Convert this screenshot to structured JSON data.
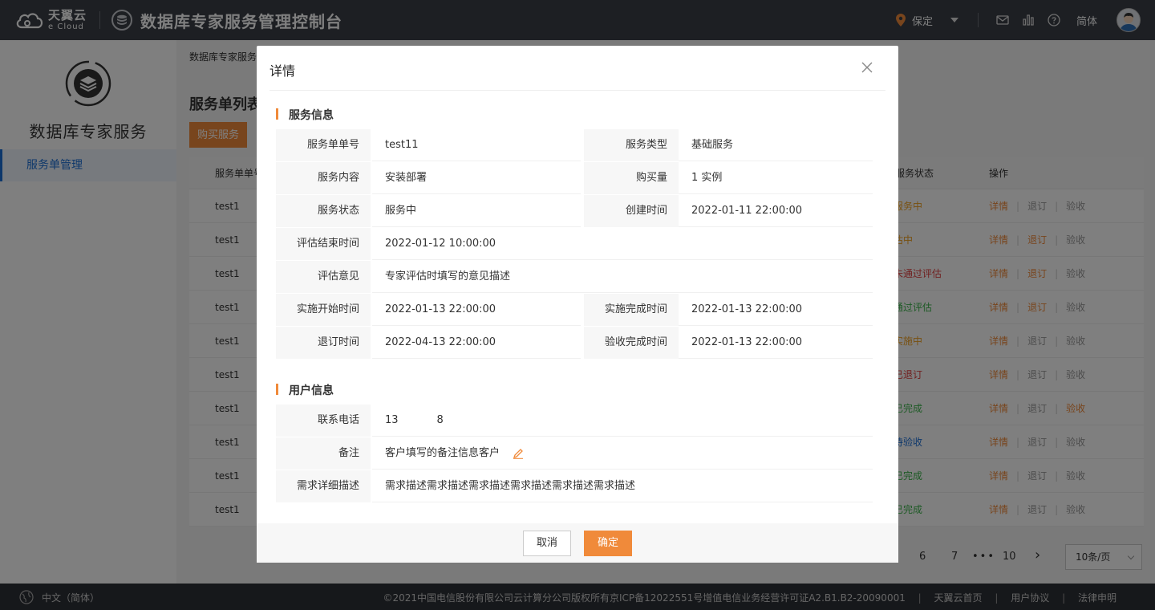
{
  "header": {
    "brand_cn": "天翼云",
    "brand_en": "e Cloud",
    "app_title": "数据库专家服务管理控制台",
    "location": "保定",
    "language": "简体",
    "icons": [
      "mail-icon",
      "chart-icon",
      "help-icon"
    ]
  },
  "sidebar": {
    "title": "数据库专家服务",
    "items": [
      {
        "label": "服务单管理",
        "active": true
      }
    ]
  },
  "main": {
    "breadcrumb": "数据库专家服务",
    "page_title": "服务单列表",
    "buy_button": "购买服务",
    "table": {
      "headers": {
        "col1": "服务单单号",
        "status": "服务状态",
        "ops": "操作"
      },
      "rows": [
        {
          "id": "test1",
          "status": "服务中",
          "status_color": "#f0a020",
          "ops": [
            "详情",
            "退订",
            "验收"
          ],
          "active_ops": []
        },
        {
          "id": "test1",
          "status": "估中",
          "status_color": "#f0a020",
          "ops": [
            "详情",
            "退订",
            "验收"
          ],
          "active_ops": [
            1
          ]
        },
        {
          "id": "test1",
          "status": "未通过评估",
          "status_color": "#e04040",
          "ops": [
            "详情",
            "退订",
            "验收"
          ],
          "active_ops": [
            1
          ]
        },
        {
          "id": "test1",
          "status": "通过评估",
          "status_color": "#3bb54a",
          "ops": [
            "详情",
            "退订",
            "验收"
          ],
          "active_ops": [
            1
          ]
        },
        {
          "id": "test1",
          "status": "实施中",
          "status_color": "#f0a020",
          "ops": [
            "详情",
            "退订",
            "验收"
          ],
          "active_ops": []
        },
        {
          "id": "test1",
          "status": "已退订",
          "status_color": "#e04040",
          "ops": [
            "详情",
            "退订",
            "验收"
          ],
          "active_ops": []
        },
        {
          "id": "test1",
          "status": "已完成",
          "status_color": "#3bb54a",
          "ops": [
            "详情",
            "退订",
            "验收"
          ],
          "active_ops": [
            2
          ]
        },
        {
          "id": "test1",
          "status": "待验收",
          "status_color": "#1a6fd6",
          "ops": [
            "详情",
            "退订",
            "验收"
          ],
          "active_ops": []
        },
        {
          "id": "test1",
          "status": "已完成",
          "status_color": "#3bb54a",
          "ops": [
            "详情",
            "退订",
            "验收"
          ],
          "active_ops": []
        },
        {
          "id": "test1",
          "status": "已完成",
          "status_color": "#3bb54a",
          "ops": [
            "详情",
            "退订",
            "验收"
          ],
          "active_ops": []
        }
      ]
    },
    "pager": {
      "pages": [
        "6",
        "7",
        "•••",
        "10"
      ],
      "next": "›",
      "page_size": "10条/页"
    }
  },
  "footer": {
    "language": "中文（简体）",
    "copyright": "©2021中国电信股份有限公司云计算分公司版权所有京ICP备12022551号增值电信业务经营许可证A2.B1.B2-20090001",
    "links": [
      "天翼云首页",
      "用户协议",
      "法律申明"
    ]
  },
  "modal": {
    "title": "详情",
    "service_section": {
      "title": "服务信息",
      "rows": [
        {
          "l1": "服务单单号",
          "v1": "test11",
          "l2": "服务类型",
          "v2": "基础服务"
        },
        {
          "l1": "服务内容",
          "v1": "安装部署",
          "l2": "购买量",
          "v2": "1 实例"
        },
        {
          "l1": "服务状态",
          "v1": "服务中",
          "l2": "创建时间",
          "v2": "2022-01-11 22:00:00"
        },
        {
          "l1": "评估结束时间",
          "v1": "2022-01-12 10:00:00"
        },
        {
          "l1": "评估意见",
          "v1": "专家评估时填写的意见描述"
        },
        {
          "l1": "实施开始时间",
          "v1": "2022-01-13 22:00:00",
          "l2": "实施完成时间",
          "v2": "2022-01-13 22:00:00"
        },
        {
          "l1": "退订时间",
          "v1": "2022-04-13 22:00:00",
          "l2": "验收完成时间",
          "v2": "2022-01-13 22:00:00"
        }
      ]
    },
    "user_section": {
      "title": "用户信息",
      "phone_label": "联系电话",
      "phone_prefix": "13",
      "phone_suffix": "8",
      "remark_label": "备注",
      "remark_value": "客户填写的备注信息客户",
      "desc_label": "需求详细描述",
      "desc_value": "需求描述需求描述需求描述需求描述需求描述需求描述"
    },
    "buttons": {
      "cancel": "取消",
      "ok": "确定"
    }
  }
}
